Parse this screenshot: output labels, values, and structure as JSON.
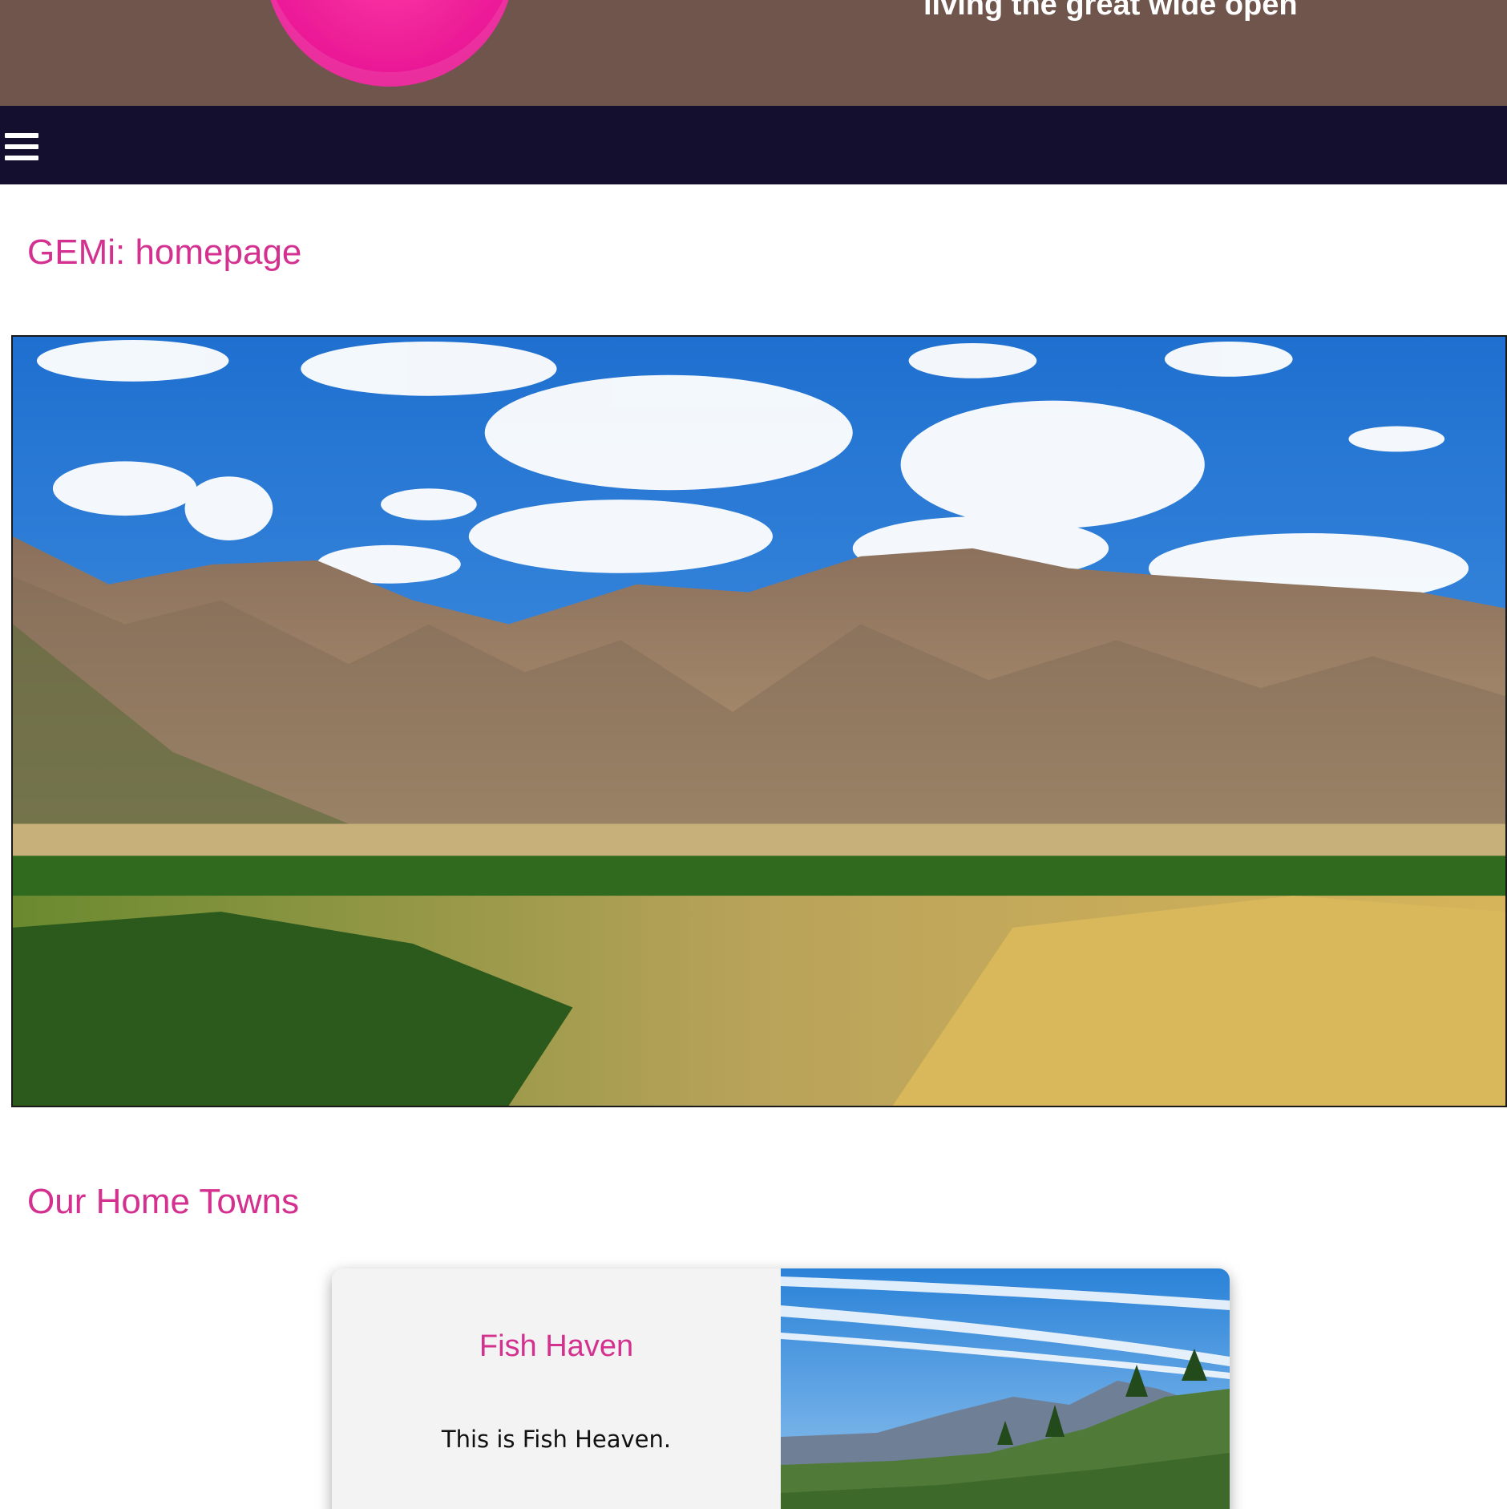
{
  "header": {
    "tagline": "living the great wide open"
  },
  "navbar": {
    "menu_icon": "hamburger-menu-icon"
  },
  "page": {
    "title": "GEMi: homepage"
  },
  "hero_image": {
    "subject": "mountain valley landscape"
  },
  "section": {
    "title": "Our Home Towns"
  },
  "towns": [
    {
      "name": "Fish Haven",
      "description": "This is Fish Heaven."
    }
  ],
  "colors": {
    "header_bg": "#6f554b",
    "nav_bg": "#140f2e",
    "accent_pink": "#d4308f",
    "logo_pink": "#f01d9c"
  }
}
